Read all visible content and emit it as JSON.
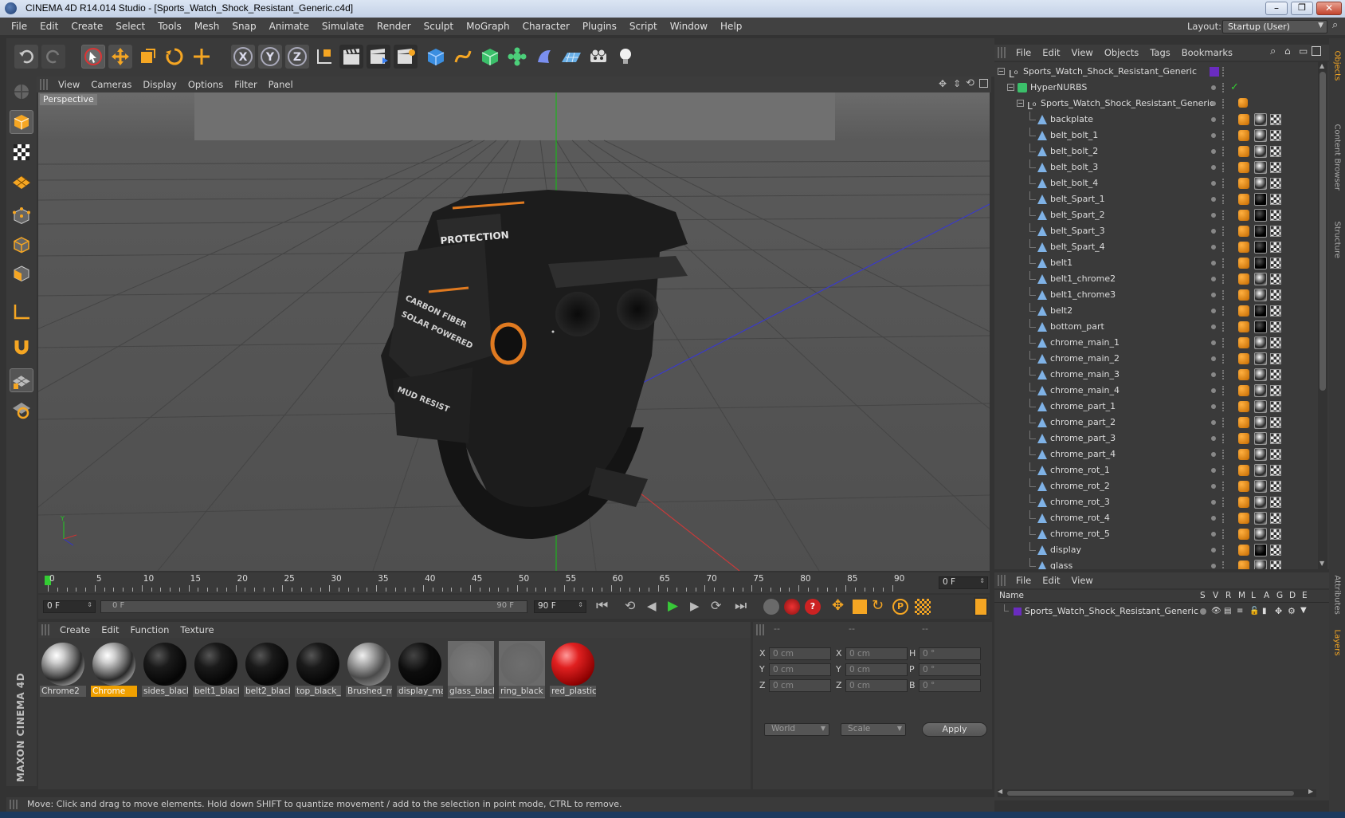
{
  "window": {
    "title": "CINEMA 4D R14.014 Studio - [Sports_Watch_Shock_Resistant_Generic.c4d]"
  },
  "menu": [
    "File",
    "Edit",
    "Create",
    "Select",
    "Tools",
    "Mesh",
    "Snap",
    "Animate",
    "Simulate",
    "Render",
    "Sculpt",
    "MoGraph",
    "Character",
    "Plugins",
    "Script",
    "Window",
    "Help"
  ],
  "layout": {
    "label": "Layout:",
    "value": "Startup (User)"
  },
  "viewport": {
    "menu": [
      "View",
      "Cameras",
      "Display",
      "Options",
      "Filter",
      "Panel"
    ],
    "camera_label": "Perspective",
    "watch_texts": [
      "PROTECTION",
      "CARBON FIBER",
      "SOLAR POWERED",
      "MUD RESIST"
    ]
  },
  "timeline": {
    "ticks": [
      "0",
      "5",
      "10",
      "15",
      "20",
      "25",
      "30",
      "35",
      "40",
      "45",
      "50",
      "55",
      "60",
      "65",
      "70",
      "75",
      "80",
      "85",
      "90"
    ],
    "current_frame": "0 F",
    "start_field": "0 F",
    "range_start": "0 F",
    "range_end": "90 F",
    "end_field": "90 F"
  },
  "materials": {
    "menu": [
      "Create",
      "Edit",
      "Function",
      "Texture"
    ],
    "items": [
      {
        "name": "Chrome2",
        "style": "chrome",
        "selected": false
      },
      {
        "name": "Chrome",
        "style": "chrome",
        "selected": true
      },
      {
        "name": "sides_black",
        "style": "black",
        "selected": false
      },
      {
        "name": "belt1_black",
        "style": "black",
        "selected": false
      },
      {
        "name": "belt2_black",
        "style": "black",
        "selected": false
      },
      {
        "name": "top_black_",
        "style": "black",
        "selected": false
      },
      {
        "name": "Brushed_m",
        "style": "brushed",
        "selected": false
      },
      {
        "name": "display_ma",
        "style": "display",
        "selected": false
      },
      {
        "name": "glass_black",
        "style": "glass",
        "selected": false
      },
      {
        "name": "ring_black",
        "style": "ring",
        "selected": false
      },
      {
        "name": "red_plastic",
        "style": "red",
        "selected": false
      }
    ]
  },
  "coordinates": {
    "headers": [
      "--",
      "--",
      "--"
    ],
    "rows": [
      {
        "a": "X",
        "av": "0 cm",
        "b": "X",
        "bv": "0 cm",
        "c": "H",
        "cv": "0 °"
      },
      {
        "a": "Y",
        "av": "0 cm",
        "b": "Y",
        "bv": "0 cm",
        "c": "P",
        "cv": "0 °"
      },
      {
        "a": "Z",
        "av": "0 cm",
        "b": "Z",
        "bv": "0 cm",
        "c": "B",
        "cv": "0 °"
      }
    ],
    "mode1": "World",
    "mode2": "Scale",
    "apply": "Apply"
  },
  "object_manager": {
    "menu": [
      "File",
      "Edit",
      "View",
      "Objects",
      "Tags",
      "Bookmarks"
    ],
    "root": "Sports_Watch_Shock_Resistant_Generic",
    "nurbs": "HyperNURBS",
    "group": "Sports_Watch_Shock_Resistant_Generic",
    "objects": [
      "backplate",
      "belt_bolt_1",
      "belt_bolt_2",
      "belt_bolt_3",
      "belt_bolt_4",
      "belt_Spart_1",
      "belt_Spart_2",
      "belt_Spart_3",
      "belt_Spart_4",
      "belt1",
      "belt1_chrome2",
      "belt1_chrome3",
      "belt2",
      "bottom_part",
      "chrome_main_1",
      "chrome_main_2",
      "chrome_main_3",
      "chrome_main_4",
      "chrome_part_1",
      "chrome_part_2",
      "chrome_part_3",
      "chrome_part_4",
      "chrome_rot_1",
      "chrome_rot_2",
      "chrome_rot_3",
      "chrome_rot_4",
      "chrome_rot_5",
      "display",
      "glass"
    ]
  },
  "layers": {
    "menu": [
      "File",
      "Edit",
      "View"
    ],
    "columns": [
      "Name",
      "S",
      "V",
      "R",
      "M",
      "L",
      "A",
      "G",
      "D",
      "E"
    ],
    "item": "Sports_Watch_Shock_Resistant_Generic"
  },
  "side_tabs": [
    "Objects",
    "Content Browser",
    "Structure",
    "Attributes",
    "Layers"
  ],
  "status": "Move: Click and drag to move elements. Hold down SHIFT to quantize movement / add to the selection in point mode, CTRL to remove.",
  "brand": "MAXON CINEMA 4D",
  "colors": {
    "accent": "#f0a000",
    "layer_purple": "#6a2cc0"
  }
}
